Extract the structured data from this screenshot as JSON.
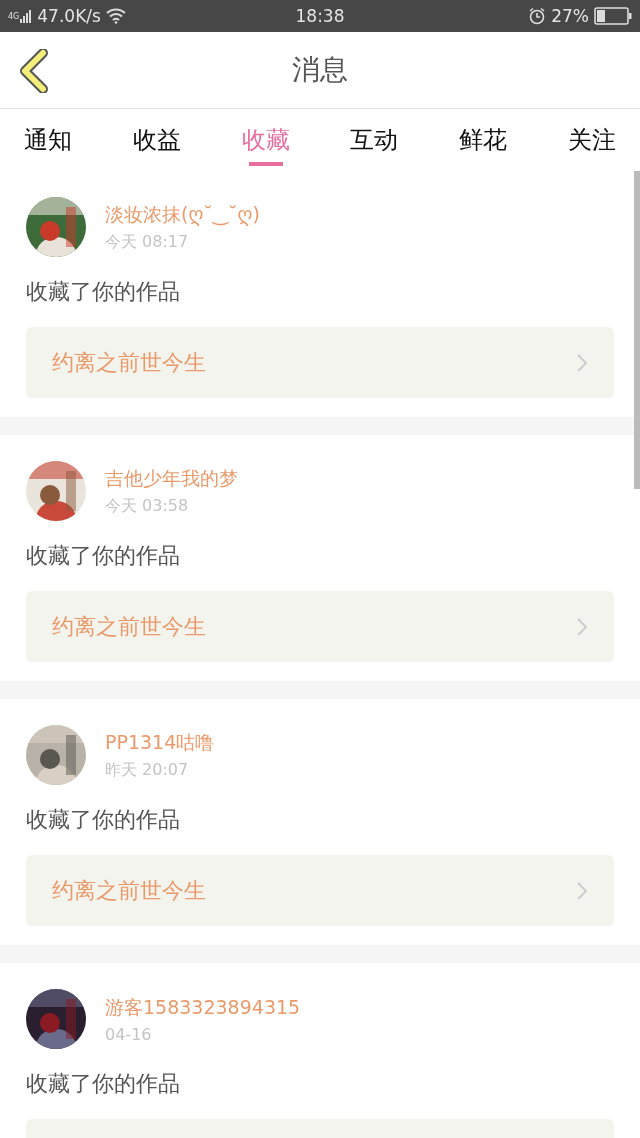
{
  "status_bar": {
    "network": "4G",
    "speed": "47.0K/s",
    "time": "18:38",
    "battery": "27%"
  },
  "header": {
    "title": "消息"
  },
  "tabs": [
    {
      "label": "通知",
      "selected": false
    },
    {
      "label": "收益",
      "selected": false
    },
    {
      "label": "收藏",
      "selected": true
    },
    {
      "label": "互动",
      "selected": false
    },
    {
      "label": "鲜花",
      "selected": false
    },
    {
      "label": "关注",
      "selected": false
    }
  ],
  "messages": [
    {
      "user": "淡妆浓抹(ღ˘‿˘ღ)",
      "time": "今天 08:17",
      "action": "收藏了你的作品",
      "work": {
        "title": "约离之前世今生"
      }
    },
    {
      "user": "吉他少年我的梦",
      "time": "今天 03:58",
      "action": "收藏了你的作品",
      "work": {
        "title": "约离之前世今生"
      }
    },
    {
      "user": "PP1314咕噜",
      "time": "昨天 20:07",
      "action": "收藏了你的作品",
      "work": {
        "title": "约离之前世今生"
      }
    },
    {
      "user": "游客1583323894315",
      "time": "04-16",
      "action": "收藏了你的作品"
    }
  ]
}
